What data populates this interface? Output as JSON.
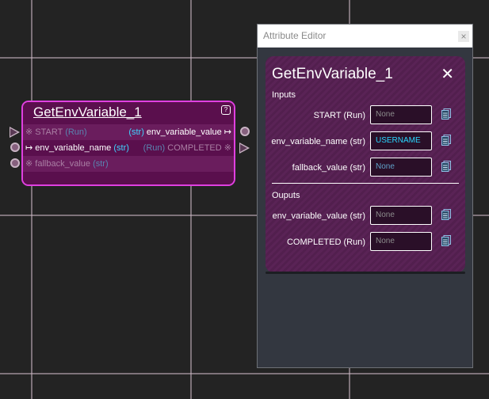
{
  "node": {
    "title": "GetEnvVariable_1",
    "help": "?",
    "rows": [
      {
        "left_prefix": "※ ",
        "left_name": "START",
        "left_type": "(Run)",
        "right_type": "(str)",
        "right_name": "env_variable_value",
        "right_suffix": " ↦"
      },
      {
        "left_prefix": "↦ ",
        "left_name": "env_variable_name",
        "left_type": "(str)",
        "right_type": "(Run)",
        "right_name": "COMPLETED",
        "right_suffix": " ※"
      },
      {
        "left_prefix": "※ ",
        "left_name": "fallback_value",
        "left_type": "(str)"
      }
    ]
  },
  "editor": {
    "window_title": "Attribute Editor",
    "close_label": "×",
    "panel_title": "GetEnvVariable_1",
    "panel_close": "✕",
    "inputs_heading": "Inputs",
    "outputs_heading": "Ouputs",
    "inputs": [
      {
        "label": "START (Run)",
        "value": "None"
      },
      {
        "label": "env_variable_name (str)",
        "value": "USERNAME"
      },
      {
        "label": "fallback_value (str)",
        "value": "None"
      }
    ],
    "outputs": [
      {
        "label": "env_variable_value (str)",
        "value": "None"
      },
      {
        "label": "COMPLETED (Run)",
        "value": "None"
      }
    ]
  },
  "colors": {
    "accent": "#e040e0",
    "type_color": "#3fd4ff",
    "value_highlight": "#29d8ff"
  }
}
